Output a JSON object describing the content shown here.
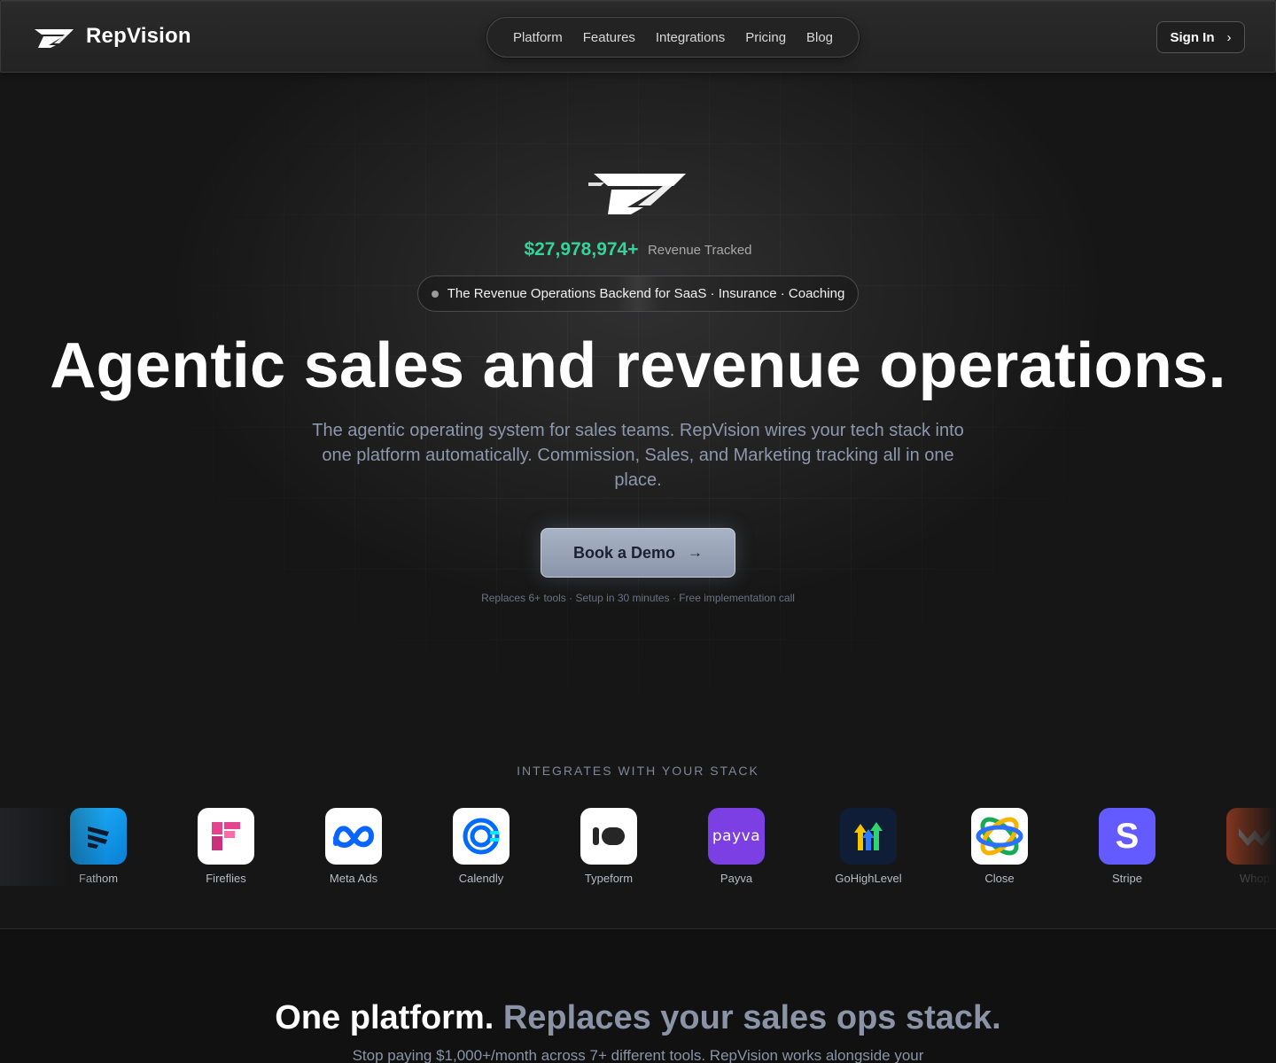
{
  "header": {
    "brand_name": "RepVision",
    "nav": [
      "Platform",
      "Features",
      "Integrations",
      "Pricing",
      "Blog"
    ],
    "signin_label": "Sign In",
    "signin_icon": "chevron-right-icon"
  },
  "hero": {
    "revenue_amount": "$27,978,974+",
    "revenue_label": "Revenue Tracked",
    "pill_text": "The Revenue Operations Backend for SaaS · Insurance · Coaching",
    "headline": "Agentic sales and revenue operations.",
    "subtitle": "The agentic operating system for sales teams. RepVision wires your tech stack into one platform automatically. Commission, Sales, and Marketing tracking all in one place.",
    "cta_label": "Book a Demo",
    "cta_icon": "arrow-right-icon",
    "cta_note": "Replaces 6+ tools · Setup in 30 minutes · Free implementation call"
  },
  "integrations": {
    "title": "INTEGRATES WITH YOUR STACK",
    "items": [
      {
        "label": "Fathom",
        "icon": "fathom-icon"
      },
      {
        "label": "Fireflies",
        "icon": "fireflies-icon"
      },
      {
        "label": "Meta Ads",
        "icon": "meta-icon"
      },
      {
        "label": "Calendly",
        "icon": "calendly-icon"
      },
      {
        "label": "Typeform",
        "icon": "typeform-icon"
      },
      {
        "label": "Payva",
        "icon": "payva-icon",
        "icon_text": "payva"
      },
      {
        "label": "GoHighLevel",
        "icon": "gohighlevel-icon"
      },
      {
        "label": "Close",
        "icon": "close-crm-icon"
      },
      {
        "label": "Stripe",
        "icon": "stripe-icon",
        "icon_text": "S"
      },
      {
        "label": "Whop",
        "icon": "whop-icon"
      }
    ]
  },
  "section": {
    "title_primary": "One platform.",
    "title_secondary": "Replaces your sales ops stack.",
    "subtitle": "Stop paying $1,000+/month across 7+ different tools. RepVision works alongside your"
  },
  "colors": {
    "accent_green": "#34d399",
    "cta_bg": "#9aa4b8",
    "muted_text": "#8e98ac",
    "background": "#161616"
  }
}
